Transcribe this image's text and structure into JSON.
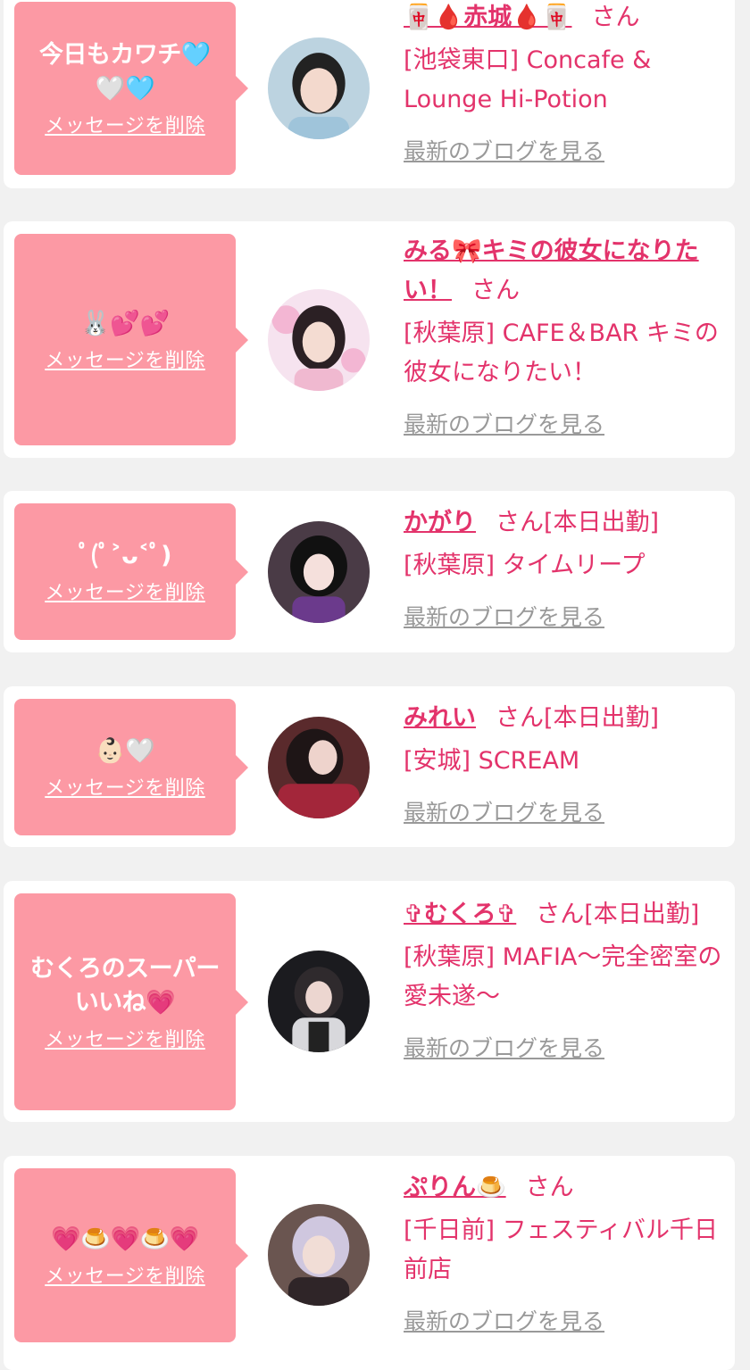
{
  "delete_label": "メッセージを削除",
  "blog_label": "最新のブログを見る",
  "san_label": "さん",
  "colors": {
    "background": "#f1f1f1",
    "card": "#ffffff",
    "bubble": "#fc99a4",
    "accent_text": "#e3336b",
    "link_gray": "#999999"
  },
  "cards": [
    {
      "message": "今日もカワチ🩵🤍🩵",
      "name": "🀄🩸赤城🩸🀄",
      "status": "",
      "shop": "[池袋東口] Concafe & Lounge Hi-Potion"
    },
    {
      "message": "🐰💕💕",
      "name": "みる🎀キミの彼女になりたい！",
      "status": "",
      "shop": "[秋葉原] CAFE＆BAR キミの彼女になりたい！"
    },
    {
      "message": "ﾟ(ﾟ˃ᴗ˂ﾟ)",
      "name": "かがり",
      "status": "[本日出勤]",
      "shop": "[秋葉原] タイムリープ"
    },
    {
      "message": "👶🏻🤍",
      "name": "みれい",
      "status": "[本日出勤]",
      "shop": "[安城] SCREAM"
    },
    {
      "message": "むくろのスーパーいいね💗",
      "name": "✞むくろ✞",
      "status": "[本日出勤]",
      "shop": "[秋葉原] MAFIA〜完全密室の愛未遂〜"
    },
    {
      "message": "💗🍮💗🍮💗",
      "name": "ぷりん🍮",
      "status": "",
      "shop": "[千日前] フェスティバル千日前店"
    }
  ]
}
